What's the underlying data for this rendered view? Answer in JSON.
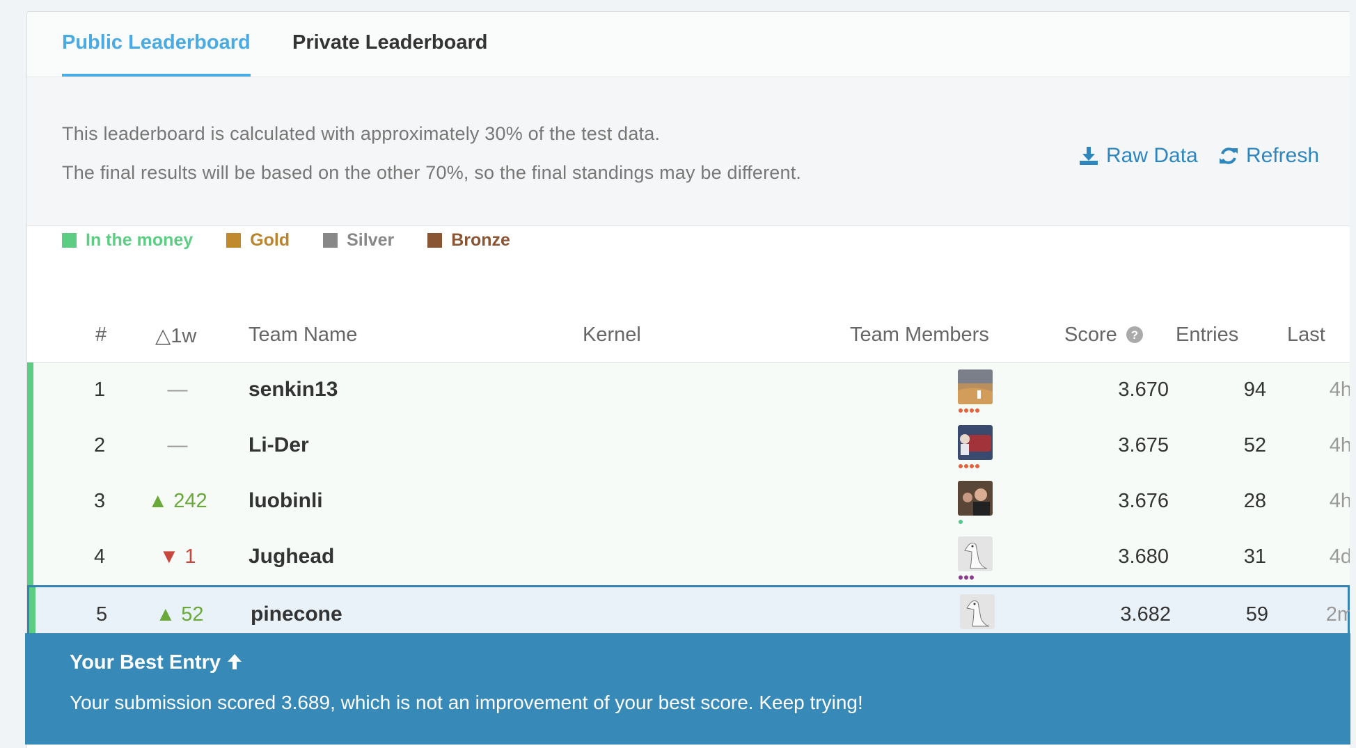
{
  "tabs": [
    {
      "label": "Public Leaderboard",
      "active": true
    },
    {
      "label": "Private Leaderboard",
      "active": false
    }
  ],
  "info": {
    "line1": "This leaderboard is calculated with approximately 30% of the test data.",
    "line2": "The final results will be based on the other 70%, so the final standings may be different.",
    "raw_data": "Raw Data",
    "refresh": "Refresh"
  },
  "legend": [
    {
      "label": "In the money",
      "color": "#5dcd84"
    },
    {
      "label": "Gold",
      "color": "#c08a2c"
    },
    {
      "label": "Silver",
      "color": "#888888"
    },
    {
      "label": "Bronze",
      "color": "#8a5533"
    }
  ],
  "table": {
    "headers": {
      "rank": "#",
      "delta": "△1w",
      "team": "Team Name",
      "kernel": "Kernel",
      "members": "Team Members",
      "score": "Score",
      "entries": "Entries",
      "last": "Last"
    },
    "rows": [
      {
        "rank": "1",
        "delta": "—",
        "delta_dir": "none",
        "team": "senkin13",
        "score": "3.670",
        "entries": "94",
        "last": "4h",
        "avatar": "desert-avatar",
        "dot_color": "#e5623a",
        "dots": 4
      },
      {
        "rank": "2",
        "delta": "—",
        "delta_dir": "none",
        "team": "Li-Der",
        "score": "3.675",
        "entries": "52",
        "last": "4h",
        "avatar": "car-avatar",
        "dot_color": "#e5623a",
        "dots": 4
      },
      {
        "rank": "3",
        "delta": "242",
        "delta_dir": "up",
        "team": "luobinli",
        "score": "3.676",
        "entries": "28",
        "last": "4h",
        "avatar": "person-avatar",
        "dot_color": "#4fc88a",
        "dots": 1
      },
      {
        "rank": "4",
        "delta": "1",
        "delta_dir": "down",
        "team": "Jughead",
        "score": "3.680",
        "entries": "31",
        "last": "4d",
        "avatar": "goose-avatar",
        "dot_color": "#8d3b8e",
        "dots": 3
      },
      {
        "rank": "5",
        "delta": "52",
        "delta_dir": "up",
        "team": "pinecone",
        "score": "3.682",
        "entries": "59",
        "last": "2m",
        "avatar": "goose-avatar",
        "dot_color": "#3fa6dc",
        "dots": 2
      }
    ]
  },
  "banner": {
    "title": "Your Best Entry",
    "message": "Your submission scored 3.689, which is not an improvement of your best score. Keep trying!"
  }
}
